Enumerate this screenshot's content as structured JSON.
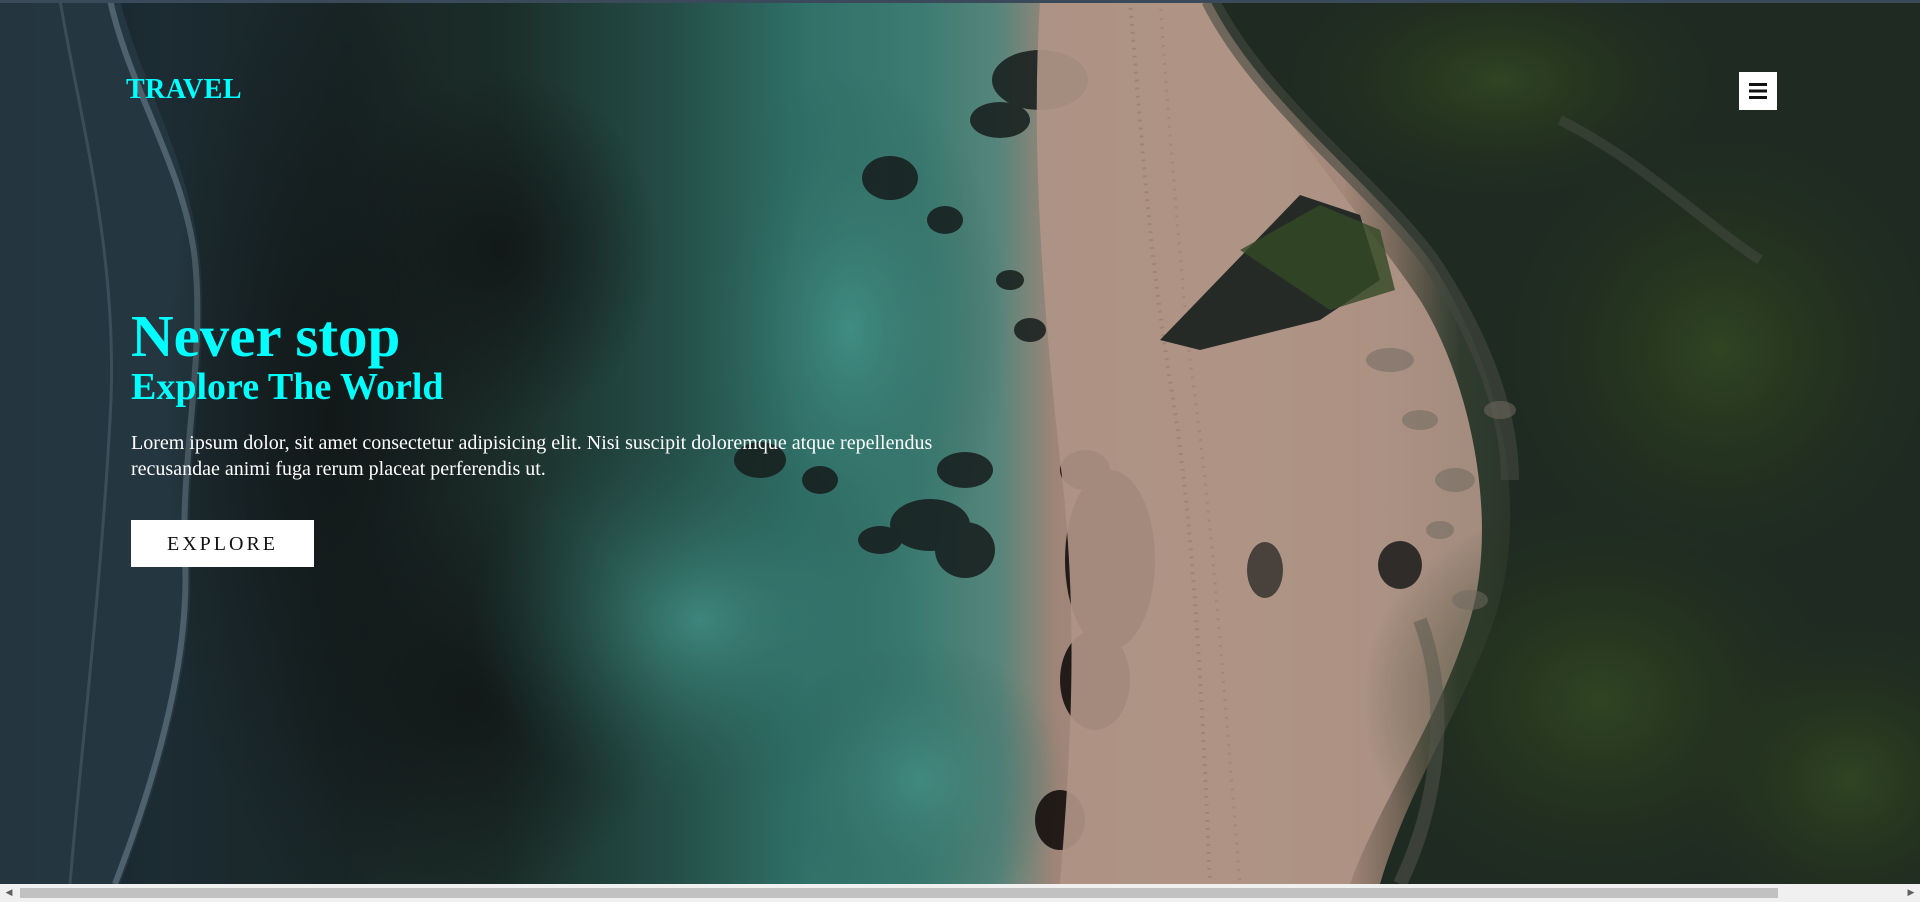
{
  "header": {
    "logo": "TRAVEL",
    "menu_icon": "hamburger-menu-icon"
  },
  "hero": {
    "title": "Never stop",
    "subtitle": "Explore The World",
    "text": "Lorem ipsum dolor, sit amet consectetur adipisicing elit. Nisi suscipit doloremque atque repellendus recusandae animi fuga rerum placeat perferendis ut.",
    "button_label": "EXPLORE",
    "background_icon": "aerial-beach-image"
  },
  "colors": {
    "accent": "#00ffff",
    "text": "#ffffff",
    "button_bg": "#ffffff",
    "button_text": "#111111"
  },
  "scrollbar": {
    "orientation": "horizontal",
    "left_arrow_icon": "scroll-left-arrow-icon",
    "right_arrow_icon": "scroll-right-arrow-icon"
  }
}
